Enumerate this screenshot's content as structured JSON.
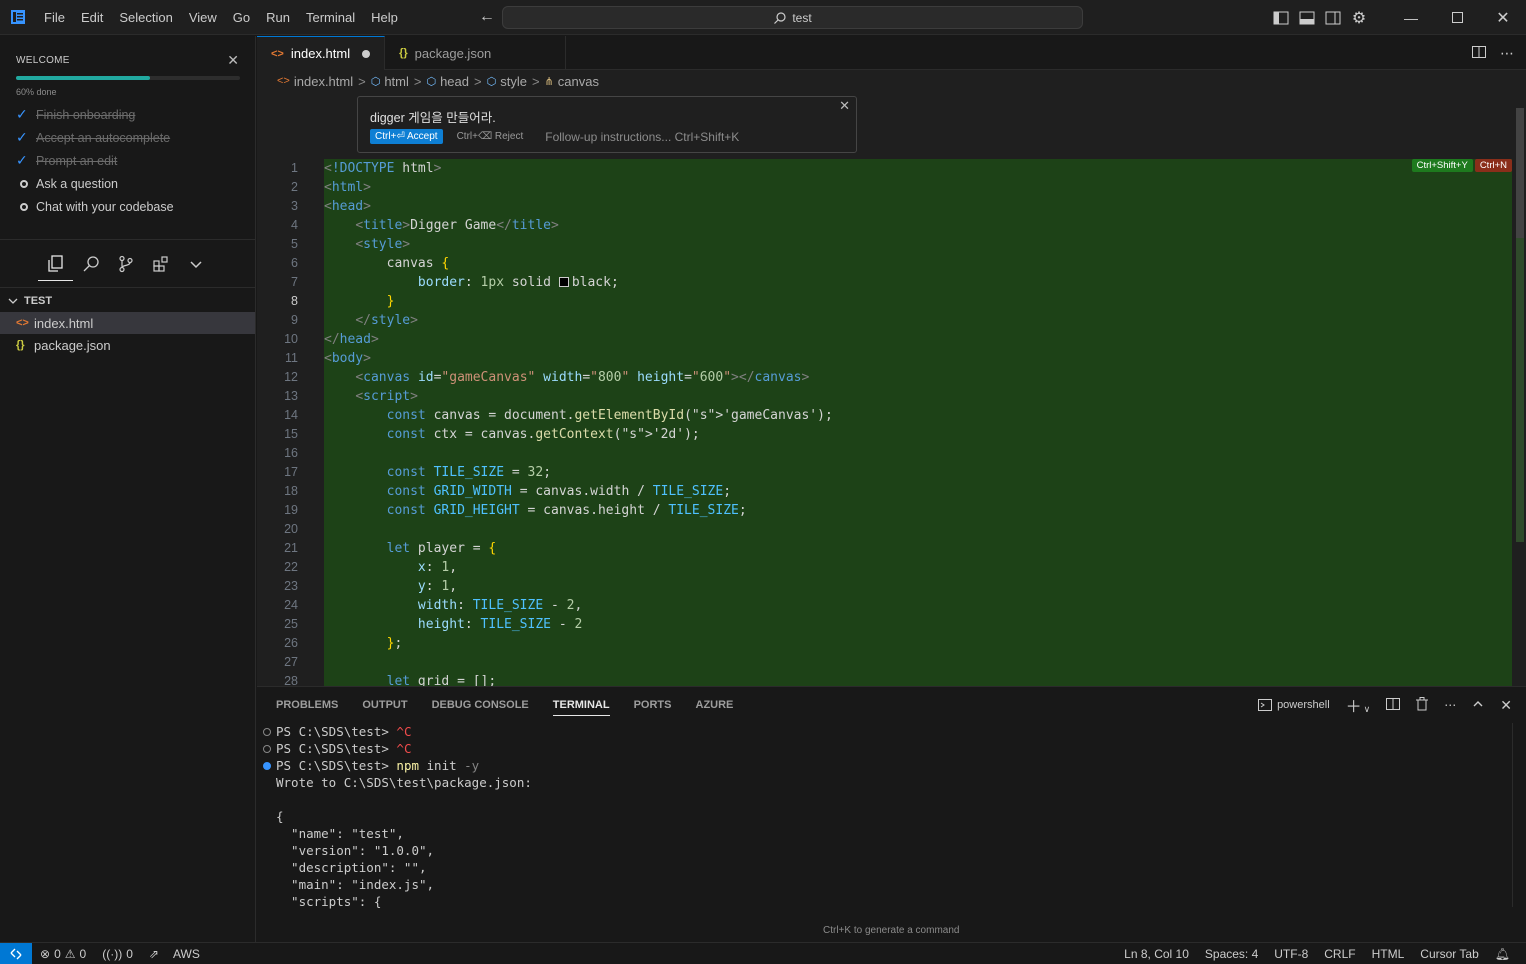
{
  "menu": [
    "File",
    "Edit",
    "Selection",
    "View",
    "Go",
    "Run",
    "Terminal",
    "Help"
  ],
  "search": {
    "text": "test"
  },
  "welcome": {
    "title": "WELCOME",
    "progress_percent": 60,
    "progress_label": "60% done",
    "tasks": [
      {
        "label": "Finish onboarding",
        "done": true
      },
      {
        "label": "Accept an autocomplete",
        "done": true
      },
      {
        "label": "Prompt an edit",
        "done": true
      },
      {
        "label": "Ask a question",
        "done": false
      },
      {
        "label": "Chat with your codebase",
        "done": false
      }
    ]
  },
  "explorer": {
    "header": "TEST",
    "files": [
      {
        "name": "index.html",
        "icon": "<>",
        "selected": true
      },
      {
        "name": "package.json",
        "icon": "{}",
        "selected": false
      }
    ]
  },
  "tabs": [
    {
      "label": "index.html",
      "icon": "<>",
      "active": true,
      "dirty": true
    },
    {
      "label": "package.json",
      "icon": "{}",
      "active": false,
      "dirty": false
    }
  ],
  "breadcrumb": [
    "index.html",
    "html",
    "head",
    "style",
    "canvas"
  ],
  "inline_prompt": {
    "text": "digger 게임을 만들어라.",
    "accept": "Ctrl+⏎ Accept",
    "reject": "Ctrl+⌫ Reject",
    "followup": "Follow-up instructions... Ctrl+Shift+K"
  },
  "diff_badges": {
    "accept": "Ctrl+Shift+Y",
    "reject": "Ctrl+N"
  },
  "current_line": 8,
  "code_lines": [
    "<!DOCTYPE html>",
    "<html>",
    "<head>",
    "    <title>Digger Game</title>",
    "    <style>",
    "        canvas {",
    "            border: 1px solid ▢black;",
    "        }",
    "    </style>",
    "</head>",
    "<body>",
    "    <canvas id=\"gameCanvas\" width=\"800\" height=\"600\"></canvas>",
    "    <script>",
    "        const canvas = document.getElementById('gameCanvas');",
    "        const ctx = canvas.getContext('2d');",
    "",
    "        const TILE_SIZE = 32;",
    "        const GRID_WIDTH = canvas.width / TILE_SIZE;",
    "        const GRID_HEIGHT = canvas.height / TILE_SIZE;",
    "",
    "        let player = {",
    "            x: 1,",
    "            y: 1,",
    "            width: TILE_SIZE - 2,",
    "            height: TILE_SIZE - 2",
    "        };",
    "",
    "        let grid = [];"
  ],
  "panel": {
    "tabs": [
      "PROBLEMS",
      "OUTPUT",
      "DEBUG CONSOLE",
      "TERMINAL",
      "PORTS",
      "AZURE"
    ],
    "active_tab": "TERMINAL",
    "shell": "powershell",
    "terminal_lines": [
      {
        "marker": "circle",
        "prompt": "PS C:\\SDS\\test> ",
        "cmd": "^C",
        "cmd_color": "red"
      },
      {
        "marker": "circle",
        "prompt": "PS C:\\SDS\\test> ",
        "cmd": "^C",
        "cmd_color": "red"
      },
      {
        "marker": "blue",
        "prompt": "PS C:\\SDS\\test> ",
        "cmd": "npm",
        "args": " init ",
        "flag": "-y"
      },
      {
        "marker": "none",
        "text": "Wrote to C:\\SDS\\test\\package.json:"
      },
      {
        "marker": "none",
        "text": ""
      },
      {
        "marker": "none",
        "text": "{"
      },
      {
        "marker": "none",
        "text": "  \"name\": \"test\","
      },
      {
        "marker": "none",
        "text": "  \"version\": \"1.0.0\","
      },
      {
        "marker": "none",
        "text": "  \"description\": \"\","
      },
      {
        "marker": "none",
        "text": "  \"main\": \"index.js\","
      },
      {
        "marker": "none",
        "text": "  \"scripts\": {"
      }
    ],
    "hint": "Ctrl+K to generate a command"
  },
  "status": {
    "errors": "0",
    "warnings": "0",
    "ports": "0",
    "aws": "AWS",
    "position": "Ln 8, Col 10",
    "spaces": "Spaces: 4",
    "encoding": "UTF-8",
    "eol": "CRLF",
    "language": "HTML",
    "cursor_tab": "Cursor Tab"
  }
}
